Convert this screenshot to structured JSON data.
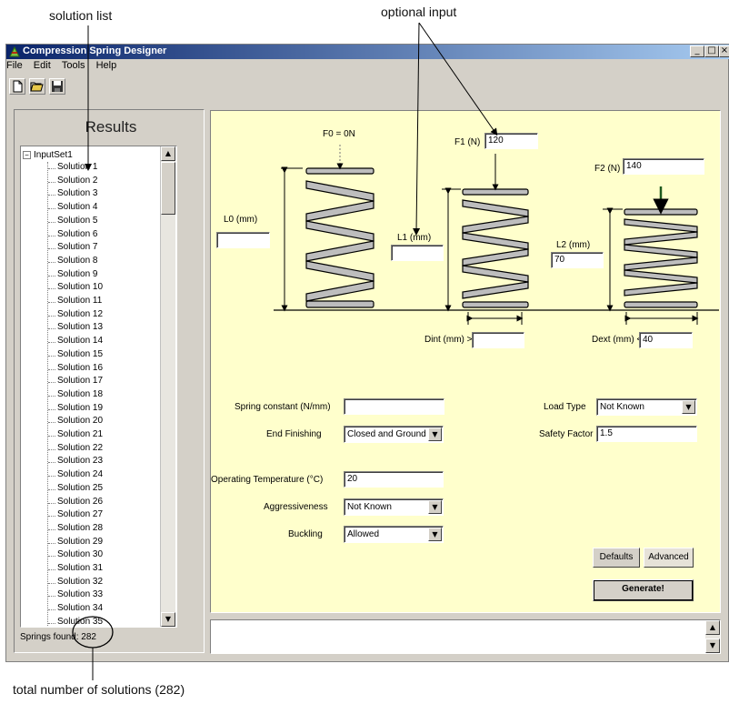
{
  "annotations": {
    "solution_list": "solution list",
    "optional_input": "optional input",
    "total_solutions": "total number of solutions (282)"
  },
  "window": {
    "title": "Compression Spring Designer",
    "minimize": "_",
    "maximize": "□",
    "close": "×"
  },
  "menu": [
    {
      "label": "File"
    },
    {
      "label": "Edit"
    },
    {
      "label": "Tools"
    },
    {
      "label": "Help"
    }
  ],
  "toolbar": {
    "items": [
      "new-icon",
      "open-icon",
      "save-icon"
    ]
  },
  "results": {
    "title": "Results",
    "root": "InputSet1",
    "expander": "−",
    "items": [
      "Solution 1",
      "Solution 2",
      "Solution 3",
      "Solution 4",
      "Solution 5",
      "Solution 6",
      "Solution 7",
      "Solution 8",
      "Solution 9",
      "Solution 10",
      "Solution 11",
      "Solution 12",
      "Solution 13",
      "Solution 14",
      "Solution 15",
      "Solution 16",
      "Solution 17",
      "Solution 18",
      "Solution 19",
      "Solution 20",
      "Solution 21",
      "Solution 22",
      "Solution 23",
      "Solution 24",
      "Solution 25",
      "Solution 26",
      "Solution 27",
      "Solution 28",
      "Solution 29",
      "Solution 30",
      "Solution 31",
      "Solution 32",
      "Solution 33",
      "Solution 34",
      "Solution 35"
    ],
    "springs_found": "Springs found: 282"
  },
  "springs": {
    "f0_label": "F0 = 0N",
    "f1_label": "F1 (N)",
    "f1_value": "120",
    "f2_label": "F2 (N)",
    "f2_value": "140",
    "l0_label": "L0 (mm)",
    "l0_value": "",
    "l1_label": "L1 (mm)",
    "l1_value": "",
    "l2_label": "L2 (mm)",
    "l2_value": "70",
    "dint_label": "Dint (mm) >",
    "dint_value": "",
    "dext_label": "Dext (mm) <",
    "dext_value": "40"
  },
  "form": {
    "spring_constant_label": "Spring constant (N/mm)",
    "spring_constant_value": "",
    "end_finishing_label": "End Finishing",
    "end_finishing_value": "Closed and Ground",
    "operating_temp_label": "Operating Temperature (°C)",
    "operating_temp_value": "20",
    "aggressiveness_label": "Aggressiveness",
    "aggressiveness_value": "Not Known",
    "buckling_label": "Buckling",
    "buckling_value": "Allowed",
    "load_type_label": "Load Type",
    "load_type_value": "Not Known",
    "safety_factor_label": "Safety Factor",
    "safety_factor_value": "1.5"
  },
  "buttons": {
    "defaults": "Defaults",
    "advanced": "Advanced",
    "generate": "Generate!"
  },
  "scroll": {
    "up": "▲",
    "down": "▼"
  }
}
